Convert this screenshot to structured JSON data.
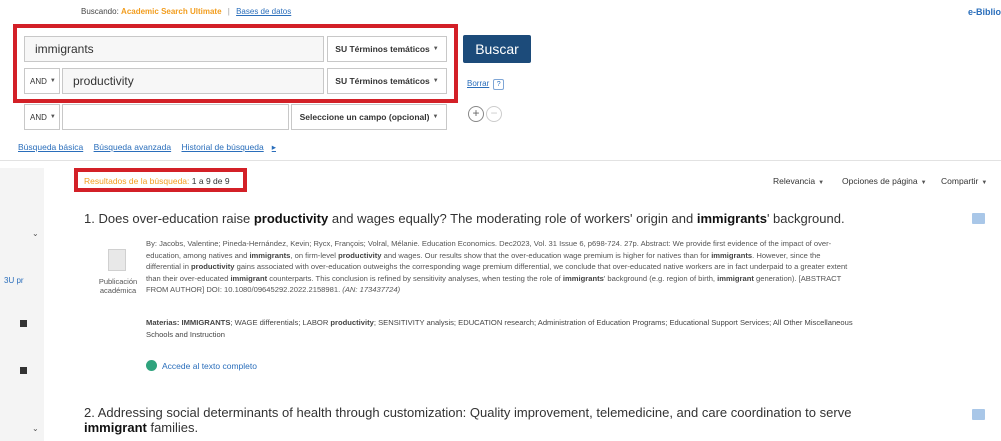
{
  "header": {
    "searching_label": "Buscando:",
    "database": "Academic Search Ultimate",
    "separator": "|",
    "databases_link": "Bases de datos",
    "brand": "e-Biblio"
  },
  "search": {
    "rows": [
      {
        "bool": "",
        "term": "immigrants",
        "field": "SU Términos temáticos"
      },
      {
        "bool": "AND",
        "term": "productivity",
        "field": "SU Términos temáticos"
      },
      {
        "bool": "AND",
        "term": "",
        "field": "Seleccione un campo (opcional)"
      }
    ],
    "search_button": "Buscar",
    "clear_link": "Borrar",
    "help": "?",
    "add": "+",
    "remove": "−"
  },
  "nav": {
    "basic": "Búsqueda básica",
    "advanced": "Búsqueda avanzada",
    "history": "Historial de búsqueda",
    "history_caret": "▸"
  },
  "sidebar": {
    "partial_text": "3U pr"
  },
  "results": {
    "label": "Resultados de la búsqueda:",
    "count": "1 a 9 de 9",
    "tools": {
      "relevance": "Relevancia",
      "page_options": "Opciones de página",
      "share": "Compartir"
    },
    "items": [
      {
        "number": "1.",
        "title_pre": "Does over-education raise ",
        "title_bold1": "productivity",
        "title_mid": " and wages equally? The moderating role of workers' origin and ",
        "title_bold2": "immigrants",
        "title_post": "' background.",
        "pub_type": "Publicación académica",
        "abs_1a": "By: Jacobs, Valentine; Pineda-Hernández, Kevin; Rycx, François; Volral, Mélanie. Education Economics. Dec2023, Vol. 31 Issue 6, p698-724. 27p. Abstract: We provide first evidence of the impact of over-",
        "abs_2a": "education, among natives and ",
        "abs_2b": "immigrants",
        "abs_2c": ", on firm-level ",
        "abs_2d": "productivity",
        "abs_2e": " and wages. Our results show that the over-education wage premium is higher for natives than for ",
        "abs_2f": "immigrants",
        "abs_2g": ". However, since the",
        "abs_3a": "differential in ",
        "abs_3b": "productivity",
        "abs_3c": " gains associated with over-education outweighs the corresponding wage premium differential, we conclude that over-educated native workers are in fact underpaid to a greater extent",
        "abs_4a": "than their over-educated ",
        "abs_4b": "immigrant",
        "abs_4c": " counterparts. This conclusion is refined by sensitivity analyses, when testing the role of ",
        "abs_4d": "immigrants",
        "abs_4e": "' background (e.g. region of birth, ",
        "abs_4f": "immigrant",
        "abs_4g": " generation). [ABSTRACT",
        "abs_5a": "FROM AUTHOR] DOI: 10.1080/09645292.2022.2158981. ",
        "abs_5b": "(AN: 173437724)",
        "subjects_label": "Materias:",
        "subjects_1": " IMMIGRANTS",
        "subjects_2": "; WAGE differentials; LABOR ",
        "subjects_3": "productivity",
        "subjects_4": "; SENSITIVITY analysis; EDUCATION research; Administration of Education Programs; Educational Support Services; All Other Miscellaneous",
        "subjects_5": "Schools and Instruction",
        "fulltext": "Accede al texto completo"
      },
      {
        "number": "2.",
        "title_line1": "Addressing social determinants of health through customization: Quality improvement, telemedicine, and care coordination to serve",
        "title_bold": "immigrant",
        "title_post": " families."
      }
    ]
  },
  "colors": {
    "accent_orange": "#f29d1e",
    "link_blue": "#2a6ebb",
    "button_navy": "#1c4b7a",
    "highlight_red": "#d32027"
  }
}
